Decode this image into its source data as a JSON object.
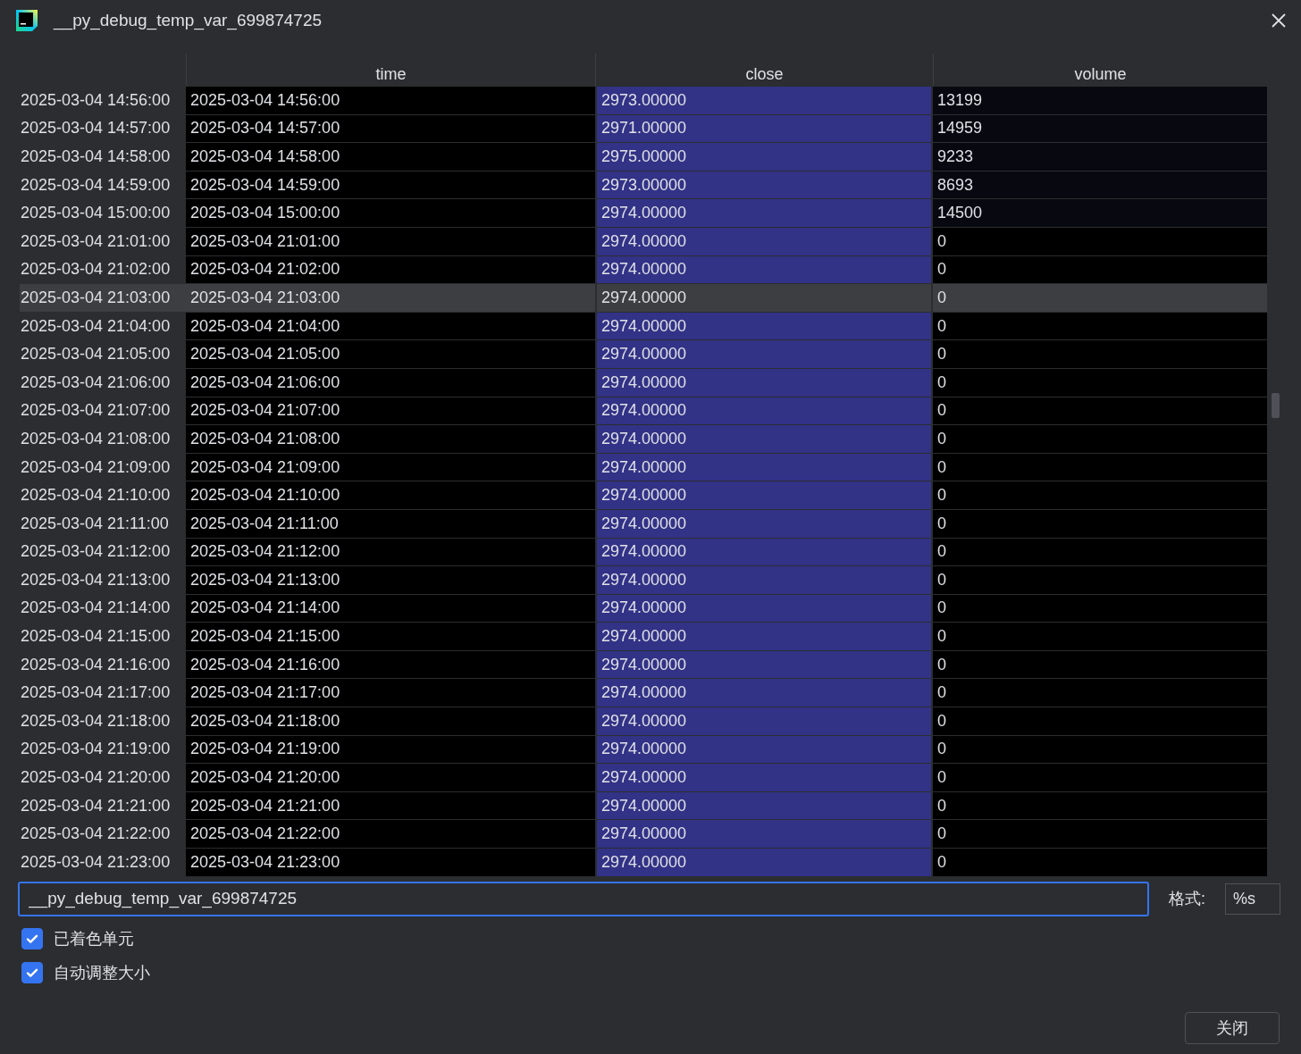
{
  "window": {
    "title": "__py_debug_temp_var_699874725"
  },
  "table": {
    "columns": [
      "time",
      "close",
      "volume"
    ],
    "rows": [
      {
        "index": "2025-03-04 14:56:00",
        "time": "2025-03-04 14:56:00",
        "close": "2973.00000",
        "volume": {
          "text": "13199",
          "color": "#080810"
        },
        "selected": false
      },
      {
        "index": "2025-03-04 14:57:00",
        "time": "2025-03-04 14:57:00",
        "close": "2971.00000",
        "volume": {
          "text": "14959",
          "color": "#080810"
        },
        "selected": false
      },
      {
        "index": "2025-03-04 14:58:00",
        "time": "2025-03-04 14:58:00",
        "close": "2975.00000",
        "volume": {
          "text": "9233",
          "color": "#080810"
        },
        "selected": false
      },
      {
        "index": "2025-03-04 14:59:00",
        "time": "2025-03-04 14:59:00",
        "close": "2973.00000",
        "volume": {
          "text": "8693",
          "color": "#080810"
        },
        "selected": false
      },
      {
        "index": "2025-03-04 15:00:00",
        "time": "2025-03-04 15:00:00",
        "close": "2974.00000",
        "volume": {
          "text": "14500",
          "color": "#080810"
        },
        "selected": false
      },
      {
        "index": "2025-03-04 21:01:00",
        "time": "2025-03-04 21:01:00",
        "close": "2974.00000",
        "volume": {
          "text": "0",
          "color": "#000000"
        },
        "selected": false
      },
      {
        "index": "2025-03-04 21:02:00",
        "time": "2025-03-04 21:02:00",
        "close": "2974.00000",
        "volume": {
          "text": "0",
          "color": "#000000"
        },
        "selected": false
      },
      {
        "index": "2025-03-04 21:03:00",
        "time": "2025-03-04 21:03:00",
        "close": "2974.00000",
        "volume": {
          "text": "0",
          "color": "#3c3e42"
        },
        "selected": true
      },
      {
        "index": "2025-03-04 21:04:00",
        "time": "2025-03-04 21:04:00",
        "close": "2974.00000",
        "volume": {
          "text": "0",
          "color": "#000000"
        },
        "selected": false
      },
      {
        "index": "2025-03-04 21:05:00",
        "time": "2025-03-04 21:05:00",
        "close": "2974.00000",
        "volume": {
          "text": "0",
          "color": "#000000"
        },
        "selected": false
      },
      {
        "index": "2025-03-04 21:06:00",
        "time": "2025-03-04 21:06:00",
        "close": "2974.00000",
        "volume": {
          "text": "0",
          "color": "#000000"
        },
        "selected": false
      },
      {
        "index": "2025-03-04 21:07:00",
        "time": "2025-03-04 21:07:00",
        "close": "2974.00000",
        "volume": {
          "text": "0",
          "color": "#000000"
        },
        "selected": false
      },
      {
        "index": "2025-03-04 21:08:00",
        "time": "2025-03-04 21:08:00",
        "close": "2974.00000",
        "volume": {
          "text": "0",
          "color": "#000000"
        },
        "selected": false
      },
      {
        "index": "2025-03-04 21:09:00",
        "time": "2025-03-04 21:09:00",
        "close": "2974.00000",
        "volume": {
          "text": "0",
          "color": "#000000"
        },
        "selected": false
      },
      {
        "index": "2025-03-04 21:10:00",
        "time": "2025-03-04 21:10:00",
        "close": "2974.00000",
        "volume": {
          "text": "0",
          "color": "#000000"
        },
        "selected": false
      },
      {
        "index": "2025-03-04 21:11:00",
        "time": "2025-03-04 21:11:00",
        "close": "2974.00000",
        "volume": {
          "text": "0",
          "color": "#000000"
        },
        "selected": false
      },
      {
        "index": "2025-03-04 21:12:00",
        "time": "2025-03-04 21:12:00",
        "close": "2974.00000",
        "volume": {
          "text": "0",
          "color": "#000000"
        },
        "selected": false
      },
      {
        "index": "2025-03-04 21:13:00",
        "time": "2025-03-04 21:13:00",
        "close": "2974.00000",
        "volume": {
          "text": "0",
          "color": "#000000"
        },
        "selected": false
      },
      {
        "index": "2025-03-04 21:14:00",
        "time": "2025-03-04 21:14:00",
        "close": "2974.00000",
        "volume": {
          "text": "0",
          "color": "#000000"
        },
        "selected": false
      },
      {
        "index": "2025-03-04 21:15:00",
        "time": "2025-03-04 21:15:00",
        "close": "2974.00000",
        "volume": {
          "text": "0",
          "color": "#000000"
        },
        "selected": false
      },
      {
        "index": "2025-03-04 21:16:00",
        "time": "2025-03-04 21:16:00",
        "close": "2974.00000",
        "volume": {
          "text": "0",
          "color": "#000000"
        },
        "selected": false
      },
      {
        "index": "2025-03-04 21:17:00",
        "time": "2025-03-04 21:17:00",
        "close": "2974.00000",
        "volume": {
          "text": "0",
          "color": "#000000"
        },
        "selected": false
      },
      {
        "index": "2025-03-04 21:18:00",
        "time": "2025-03-04 21:18:00",
        "close": "2974.00000",
        "volume": {
          "text": "0",
          "color": "#000000"
        },
        "selected": false
      },
      {
        "index": "2025-03-04 21:19:00",
        "time": "2025-03-04 21:19:00",
        "close": "2974.00000",
        "volume": {
          "text": "0",
          "color": "#000000"
        },
        "selected": false
      },
      {
        "index": "2025-03-04 21:20:00",
        "time": "2025-03-04 21:20:00",
        "close": "2974.00000",
        "volume": {
          "text": "0",
          "color": "#000000"
        },
        "selected": false
      },
      {
        "index": "2025-03-04 21:21:00",
        "time": "2025-03-04 21:21:00",
        "close": "2974.00000",
        "volume": {
          "text": "0",
          "color": "#000000"
        },
        "selected": false
      },
      {
        "index": "2025-03-04 21:22:00",
        "time": "2025-03-04 21:22:00",
        "close": "2974.00000",
        "volume": {
          "text": "0",
          "color": "#000000"
        },
        "selected": false
      },
      {
        "index": "2025-03-04 21:23:00",
        "time": "2025-03-04 21:23:00",
        "close": "2974.00000",
        "volume": {
          "text": "0",
          "color": "#000000"
        },
        "selected": false
      }
    ]
  },
  "expression_field": {
    "value": "__py_debug_temp_var_699874725"
  },
  "format": {
    "label": "格式:",
    "value": "%s"
  },
  "options": [
    {
      "label": "已着色单元",
      "checked": true
    },
    {
      "label": "自动调整大小",
      "checked": true
    }
  ],
  "buttons": [
    "关闭"
  ]
}
